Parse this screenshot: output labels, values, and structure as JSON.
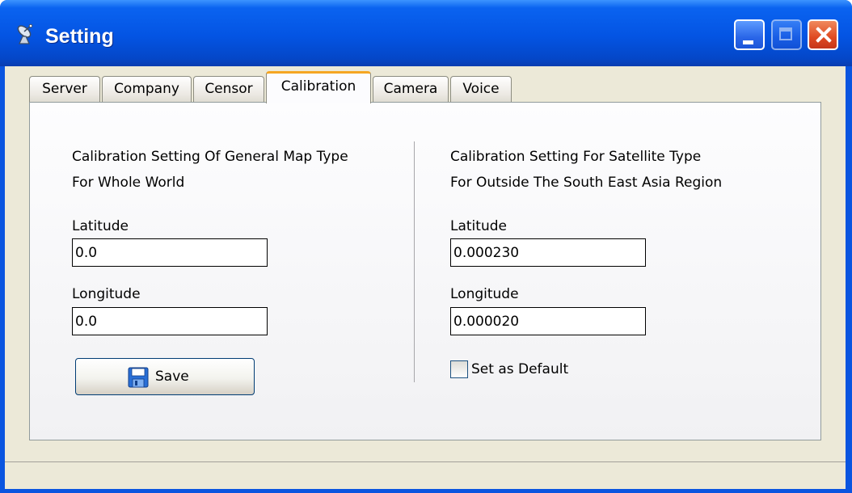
{
  "window": {
    "title": "Setting",
    "icon": "satellite-dish-icon",
    "buttons": [
      "minimize-icon",
      "maximize-icon",
      "close-icon"
    ]
  },
  "tabs": [
    {
      "label": "Server",
      "active": false
    },
    {
      "label": "Company",
      "active": false
    },
    {
      "label": "Censor",
      "active": false
    },
    {
      "label": "Calibration",
      "active": true
    },
    {
      "label": "Camera",
      "active": false
    },
    {
      "label": "Voice",
      "active": false
    }
  ],
  "general": {
    "heading_line1": "Calibration Setting Of General Map Type",
    "heading_line2": "For Whole World",
    "latitude_label": "Latitude",
    "latitude_value": "0.0",
    "longitude_label": "Longitude",
    "longitude_value": "0.0",
    "save_label": "Save"
  },
  "satellite": {
    "heading_line1": "Calibration Setting For Satellite Type",
    "heading_line2": "For Outside The South East Asia Region",
    "latitude_label": "Latitude",
    "latitude_value": "0.000230",
    "longitude_label": "Longitude",
    "longitude_value": "0.000020",
    "default_label": "Set as Default",
    "default_checked": false
  },
  "colors": {
    "titlebar": "#0454e3",
    "active_tab_accent": "#f5a623",
    "dialog_face": "#ece9d8"
  }
}
